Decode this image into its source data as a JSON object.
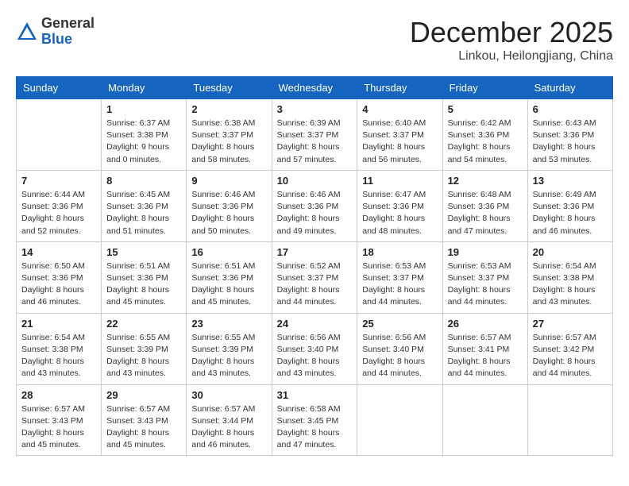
{
  "header": {
    "logo_line1": "General",
    "logo_line2": "Blue",
    "month": "December 2025",
    "location": "Linkou, Heilongjiang, China"
  },
  "columns": [
    "Sunday",
    "Monday",
    "Tuesday",
    "Wednesday",
    "Thursday",
    "Friday",
    "Saturday"
  ],
  "weeks": [
    [
      {
        "day": "",
        "info": ""
      },
      {
        "day": "1",
        "info": "Sunrise: 6:37 AM\nSunset: 3:38 PM\nDaylight: 9 hours\nand 0 minutes."
      },
      {
        "day": "2",
        "info": "Sunrise: 6:38 AM\nSunset: 3:37 PM\nDaylight: 8 hours\nand 58 minutes."
      },
      {
        "day": "3",
        "info": "Sunrise: 6:39 AM\nSunset: 3:37 PM\nDaylight: 8 hours\nand 57 minutes."
      },
      {
        "day": "4",
        "info": "Sunrise: 6:40 AM\nSunset: 3:37 PM\nDaylight: 8 hours\nand 56 minutes."
      },
      {
        "day": "5",
        "info": "Sunrise: 6:42 AM\nSunset: 3:36 PM\nDaylight: 8 hours\nand 54 minutes."
      },
      {
        "day": "6",
        "info": "Sunrise: 6:43 AM\nSunset: 3:36 PM\nDaylight: 8 hours\nand 53 minutes."
      }
    ],
    [
      {
        "day": "7",
        "info": "Sunrise: 6:44 AM\nSunset: 3:36 PM\nDaylight: 8 hours\nand 52 minutes."
      },
      {
        "day": "8",
        "info": "Sunrise: 6:45 AM\nSunset: 3:36 PM\nDaylight: 8 hours\nand 51 minutes."
      },
      {
        "day": "9",
        "info": "Sunrise: 6:46 AM\nSunset: 3:36 PM\nDaylight: 8 hours\nand 50 minutes."
      },
      {
        "day": "10",
        "info": "Sunrise: 6:46 AM\nSunset: 3:36 PM\nDaylight: 8 hours\nand 49 minutes."
      },
      {
        "day": "11",
        "info": "Sunrise: 6:47 AM\nSunset: 3:36 PM\nDaylight: 8 hours\nand 48 minutes."
      },
      {
        "day": "12",
        "info": "Sunrise: 6:48 AM\nSunset: 3:36 PM\nDaylight: 8 hours\nand 47 minutes."
      },
      {
        "day": "13",
        "info": "Sunrise: 6:49 AM\nSunset: 3:36 PM\nDaylight: 8 hours\nand 46 minutes."
      }
    ],
    [
      {
        "day": "14",
        "info": "Sunrise: 6:50 AM\nSunset: 3:36 PM\nDaylight: 8 hours\nand 46 minutes."
      },
      {
        "day": "15",
        "info": "Sunrise: 6:51 AM\nSunset: 3:36 PM\nDaylight: 8 hours\nand 45 minutes."
      },
      {
        "day": "16",
        "info": "Sunrise: 6:51 AM\nSunset: 3:36 PM\nDaylight: 8 hours\nand 45 minutes."
      },
      {
        "day": "17",
        "info": "Sunrise: 6:52 AM\nSunset: 3:37 PM\nDaylight: 8 hours\nand 44 minutes."
      },
      {
        "day": "18",
        "info": "Sunrise: 6:53 AM\nSunset: 3:37 PM\nDaylight: 8 hours\nand 44 minutes."
      },
      {
        "day": "19",
        "info": "Sunrise: 6:53 AM\nSunset: 3:37 PM\nDaylight: 8 hours\nand 44 minutes."
      },
      {
        "day": "20",
        "info": "Sunrise: 6:54 AM\nSunset: 3:38 PM\nDaylight: 8 hours\nand 43 minutes."
      }
    ],
    [
      {
        "day": "21",
        "info": "Sunrise: 6:54 AM\nSunset: 3:38 PM\nDaylight: 8 hours\nand 43 minutes."
      },
      {
        "day": "22",
        "info": "Sunrise: 6:55 AM\nSunset: 3:39 PM\nDaylight: 8 hours\nand 43 minutes."
      },
      {
        "day": "23",
        "info": "Sunrise: 6:55 AM\nSunset: 3:39 PM\nDaylight: 8 hours\nand 43 minutes."
      },
      {
        "day": "24",
        "info": "Sunrise: 6:56 AM\nSunset: 3:40 PM\nDaylight: 8 hours\nand 43 minutes."
      },
      {
        "day": "25",
        "info": "Sunrise: 6:56 AM\nSunset: 3:40 PM\nDaylight: 8 hours\nand 44 minutes."
      },
      {
        "day": "26",
        "info": "Sunrise: 6:57 AM\nSunset: 3:41 PM\nDaylight: 8 hours\nand 44 minutes."
      },
      {
        "day": "27",
        "info": "Sunrise: 6:57 AM\nSunset: 3:42 PM\nDaylight: 8 hours\nand 44 minutes."
      }
    ],
    [
      {
        "day": "28",
        "info": "Sunrise: 6:57 AM\nSunset: 3:43 PM\nDaylight: 8 hours\nand 45 minutes."
      },
      {
        "day": "29",
        "info": "Sunrise: 6:57 AM\nSunset: 3:43 PM\nDaylight: 8 hours\nand 45 minutes."
      },
      {
        "day": "30",
        "info": "Sunrise: 6:57 AM\nSunset: 3:44 PM\nDaylight: 8 hours\nand 46 minutes."
      },
      {
        "day": "31",
        "info": "Sunrise: 6:58 AM\nSunset: 3:45 PM\nDaylight: 8 hours\nand 47 minutes."
      },
      {
        "day": "",
        "info": ""
      },
      {
        "day": "",
        "info": ""
      },
      {
        "day": "",
        "info": ""
      }
    ]
  ]
}
